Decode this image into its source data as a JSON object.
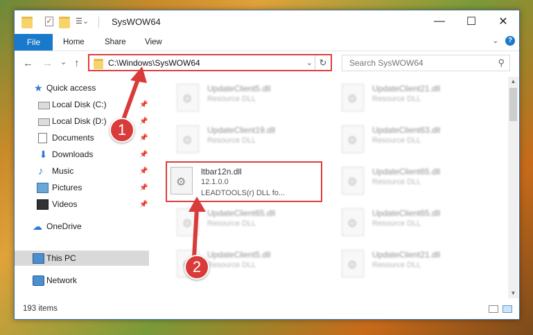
{
  "window": {
    "title": "SysWOW64"
  },
  "title_controls": {
    "minimize": "—",
    "maximize": "☐",
    "close": "✕"
  },
  "ribbon": {
    "file": "File",
    "tabs": [
      "Home",
      "Share",
      "View"
    ]
  },
  "nav": {
    "back": "←",
    "forward": "→",
    "recent": "⌄",
    "up": "↑",
    "address_path": "C:\\Windows\\SysWOW64",
    "search_placeholder": "Search SysWOW64"
  },
  "sidebar": {
    "items": [
      {
        "label": "Quick access",
        "pinned": false
      },
      {
        "label": "Local Disk (C:)",
        "pinned": true
      },
      {
        "label": "Local Disk (D:)",
        "pinned": true
      },
      {
        "label": "Documents",
        "pinned": true
      },
      {
        "label": "Downloads",
        "pinned": true
      },
      {
        "label": "Music",
        "pinned": true
      },
      {
        "label": "Pictures",
        "pinned": true
      },
      {
        "label": "Videos",
        "pinned": true
      },
      {
        "label": "OneDrive",
        "pinned": false
      },
      {
        "label": "This PC",
        "pinned": false
      },
      {
        "label": "Network",
        "pinned": false
      }
    ]
  },
  "files": {
    "left": [
      {
        "name": "UpdateClient5.dll",
        "type": "Resource DLL"
      },
      {
        "name": "UpdateClient19.dll",
        "type": "Resource DLL"
      },
      {
        "name": "ltbar12n.dll",
        "version": "12.1.0.0",
        "desc": "LEADTOOLS(r) DLL fo..."
      },
      {
        "name": "UpdateClient65.dll",
        "type": "Resource DLL"
      },
      {
        "name": "UpdateClient5.dll",
        "type": "Resource DLL"
      }
    ],
    "right": [
      {
        "name": "UpdateClient21.dll",
        "type": "Resource DLL"
      },
      {
        "name": "UpdateClient63.dll",
        "type": "Resource DLL"
      },
      {
        "name": "UpdateClient65.dll",
        "type": "Resource DLL"
      },
      {
        "name": "UpdateClient65.dll",
        "type": "Resource DLL"
      },
      {
        "name": "UpdateClient21.dll",
        "type": "Resource DLL"
      }
    ]
  },
  "status": {
    "item_count": "193 items"
  },
  "annotations": {
    "step1": "1",
    "step2": "2",
    "color": "#d93a3a"
  }
}
